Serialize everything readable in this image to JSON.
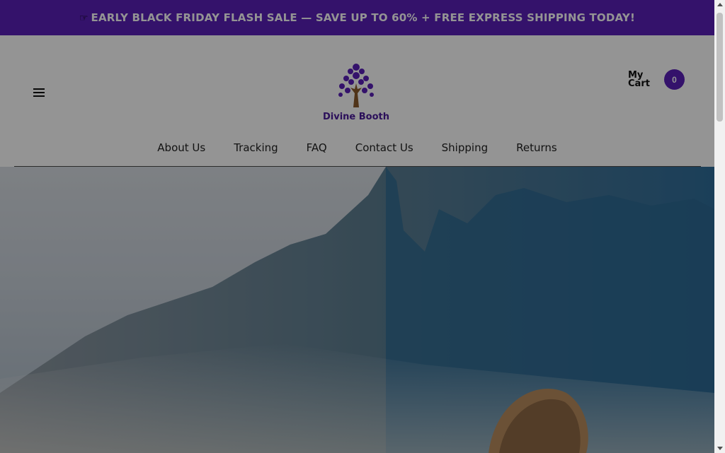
{
  "promo": {
    "icon": "pointing-hand-icon",
    "text": "EARLY BLACK FRIDAY FLASH SALE — SAVE UP TO 60% + FREE EXPRESS SHIPPING TODAY!"
  },
  "header": {
    "menu_icon": "hamburger-icon",
    "logo_text": "Divine Booth",
    "cart": {
      "label": "My Cart",
      "count": "0"
    }
  },
  "nav": {
    "items": [
      {
        "label": "About Us"
      },
      {
        "label": "Tracking"
      },
      {
        "label": "FAQ"
      },
      {
        "label": "Contact Us"
      },
      {
        "label": "Shipping"
      },
      {
        "label": "Returns"
      }
    ]
  },
  "colors": {
    "brand": "#5a1fb8",
    "logo_purple": "#4a1a9c",
    "tree_trunk": "#8a5a2b",
    "overlay": "rgba(0,0,0,0.42)"
  }
}
